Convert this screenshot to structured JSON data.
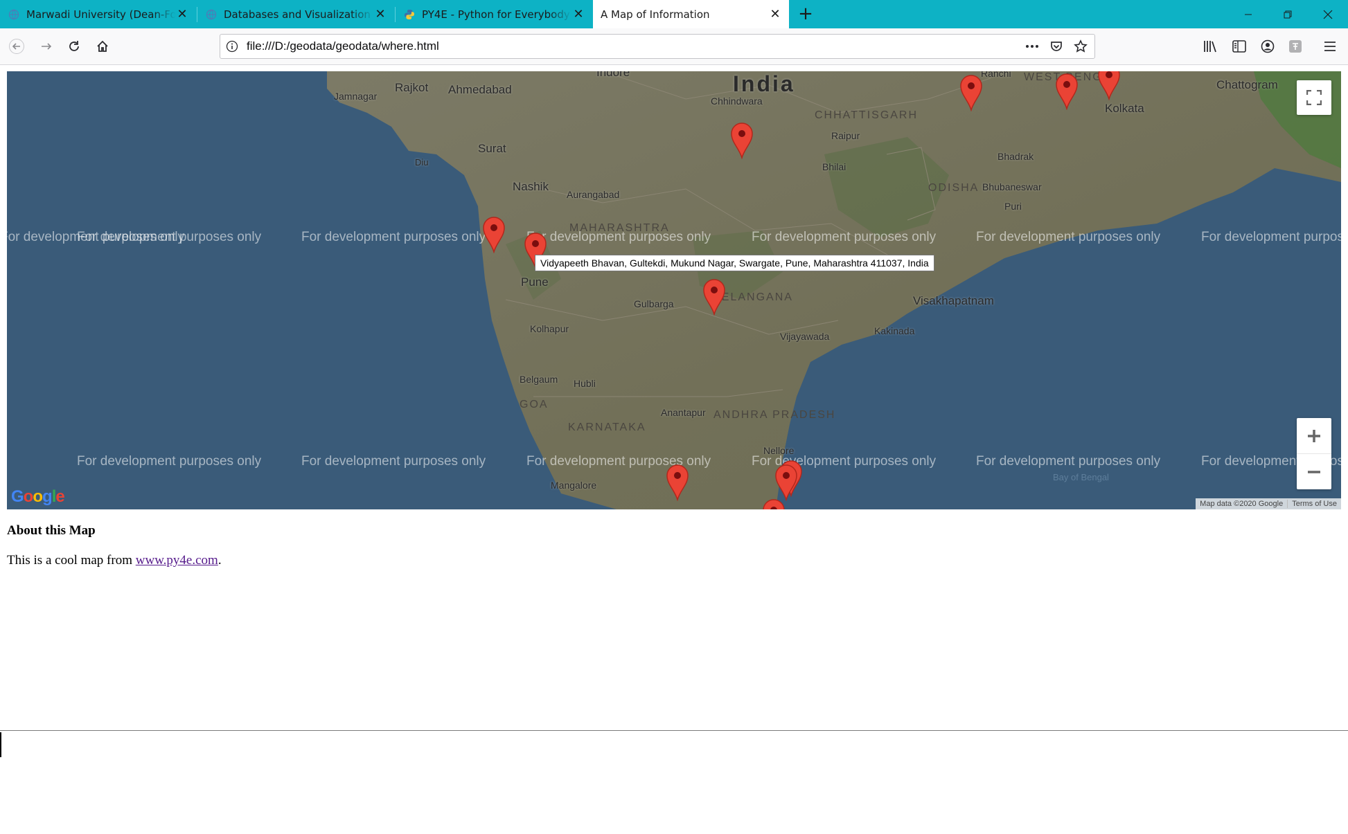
{
  "browser": {
    "tabs": [
      {
        "title": "Marwadi University (Dean-FoE)",
        "icon": "globe-icon",
        "active": false
      },
      {
        "title": "Databases and Visualization (p",
        "icon": "globe-icon",
        "active": false
      },
      {
        "title": "PY4E - Python for Everybody",
        "icon": "python-icon",
        "active": false
      },
      {
        "title": "A Map of Information",
        "icon": "none",
        "active": true
      }
    ],
    "new_tab_icon": "plus-icon",
    "url": "file:///D:/geodata/geodata/where.html",
    "colors": {
      "tab_strip": "#0db2c5",
      "toolbar": "#f9f9fa"
    }
  },
  "map": {
    "watermark": "For development purposes only",
    "country_label": "India",
    "cities": [
      "Jamnagar",
      "Rajkot",
      "Ahmedabad",
      "Indore",
      "Surat",
      "Diu",
      "Nashik",
      "Aurangabad",
      "Chhindwara",
      "Raipur",
      "Bhilai",
      "Ranchi",
      "Kolkata",
      "Chattogram",
      "Bhadrak",
      "Bhubaneswar",
      "Puri",
      "Pune",
      "Kolhapur",
      "Gulbarga",
      "Belgaum",
      "Hubli",
      "Visakhapatnam",
      "Kakinada",
      "Vijayawada",
      "Anantapur",
      "Nellore",
      "Mangalore",
      "Bay of Bengal"
    ],
    "states": [
      "CHHATTISGARH",
      "ODISHA",
      "MAHARASHTRA",
      "TELANGANA",
      "ANDHRA PRADESH",
      "KARNATAKA",
      "GOA",
      "WEST BENGAL"
    ],
    "tooltip": "Vidyapeeth Bhavan, Gultekdi, Mukund Nagar, Swargate, Pune, Maharashtra 411037, India",
    "attribution": "Map data ©2020 Google",
    "terms": "Terms of Use",
    "logo": "Google",
    "marker_color": "#ea4335"
  },
  "content": {
    "heading": "About this Map",
    "text_before": "This is a cool map from ",
    "link_text": "www.py4e.com",
    "text_after": "."
  }
}
